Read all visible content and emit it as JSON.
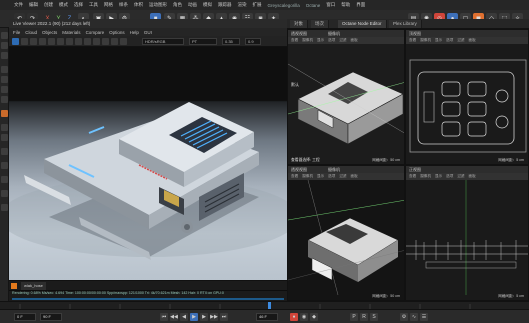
{
  "menubar": {
    "items": [
      "文件",
      "编辑",
      "创建",
      "模式",
      "选择",
      "工具",
      "网格",
      "样条",
      "体积",
      "运动图形",
      "角色",
      "动画",
      "模拟",
      "跟踪器",
      "渲染",
      "扩展",
      "窗口",
      "帮助"
    ],
    "tab_label": "Greyscalegorilla",
    "tab_label2": "Octane",
    "layout_label": "界面"
  },
  "toolbar": {
    "x_label": "X",
    "y_label": "Y",
    "z_label": "Z"
  },
  "live_viewer": {
    "title": "Live Viewer 2022.1 (90) (212 days left)",
    "menu": [
      "File",
      "Cloud",
      "Objects",
      "Materials",
      "Compare",
      "Options",
      "Help",
      "GUI"
    ],
    "mode": "HDR/sRGB",
    "kernel": "PT",
    "value1": "0.35",
    "value2": "0.9",
    "object_name": "wlak_hose",
    "status": "Rendering: 0.68%   Ms/sec: 4.694   Time: 100:00:00/00:00:00   Spp/maxspp: 121/1000   Tri: 4k/70.621m   Mesh: 142   Hair: 0   RTX:on   GPU:0"
  },
  "right_tabs": [
    "对象",
    "场次",
    "Octane Node Editor",
    "Plex Library"
  ],
  "viewports": [
    {
      "name": "透视视图",
      "camera": "摄像机",
      "menu": [
        "查看",
        "摄像机",
        "显示",
        "选项",
        "过滤",
        "面板"
      ],
      "label": "默认",
      "bottom_left": "查看器选择: 工程",
      "grid": "网格间距：50 cm"
    },
    {
      "name": "顶视图",
      "camera": "",
      "menu": [
        "查看",
        "摄像机",
        "显示",
        "选项",
        "过滤",
        "面板"
      ],
      "label": "",
      "bottom_left": "",
      "grid": "网格间距：5 cm"
    },
    {
      "name": "透视视图",
      "camera": "摄像机",
      "menu": [
        "查看",
        "摄像机",
        "显示",
        "选项",
        "过滤",
        "面板"
      ],
      "label": "",
      "bottom_left": "",
      "grid": "网格间距：50 cm"
    },
    {
      "name": "正视图",
      "camera": "",
      "menu": [
        "查看",
        "摄像机",
        "显示",
        "选项",
        "过滤",
        "面板"
      ],
      "label": "",
      "bottom_left": "",
      "grid": "网格间距：5 cm"
    }
  ],
  "transport": {
    "frame_value": "46 F",
    "start": "0 F",
    "end": "90 F"
  },
  "colors": {
    "accent_blue": "#3d6fb8",
    "orange": "#e37a1d",
    "render_blue_glow": "#4fb2ff"
  }
}
